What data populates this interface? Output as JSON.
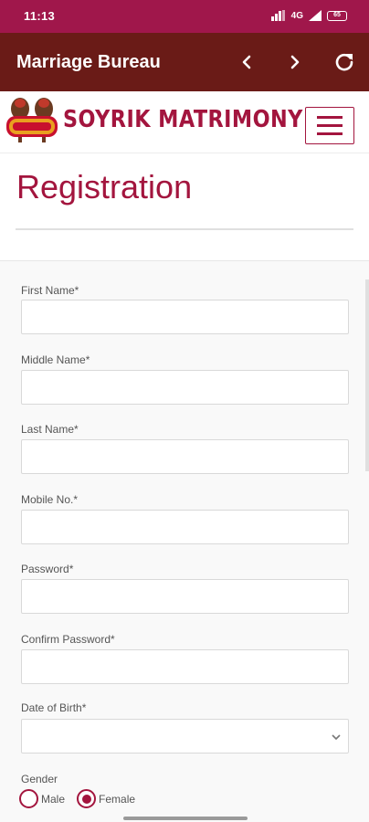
{
  "status_bar": {
    "time": "11:13",
    "network_label": "4G",
    "battery_label": "65"
  },
  "app_bar": {
    "title": "Marriage Bureau",
    "icons": [
      "chevron-left-icon",
      "chevron-right-icon",
      "refresh-icon"
    ]
  },
  "header": {
    "brand_name": "SOYRIK MATRIMONY",
    "icons": [
      "logo-emblem",
      "hamburger-menu-icon"
    ]
  },
  "page": {
    "title": "Registration"
  },
  "form": {
    "fields": [
      {
        "label": "First Name*",
        "value": "",
        "placeholder": ""
      },
      {
        "label": "Middle Name*",
        "value": "",
        "placeholder": ""
      },
      {
        "label": "Last Name*",
        "value": "",
        "placeholder": ""
      },
      {
        "label": "Mobile No.*",
        "value": "",
        "placeholder": ""
      },
      {
        "label": "Password*",
        "value": "",
        "placeholder": ""
      },
      {
        "label": "Confirm Password*",
        "value": "",
        "placeholder": ""
      }
    ],
    "dob": {
      "label": "Date of Birth*",
      "value": ""
    },
    "gender": {
      "label": "Gender",
      "options": [
        "Male",
        "Female"
      ],
      "selected": "Female"
    }
  },
  "colors": {
    "status_bar": "#a0174b",
    "app_bar": "#6a1b17",
    "accent": "#a3153e"
  }
}
